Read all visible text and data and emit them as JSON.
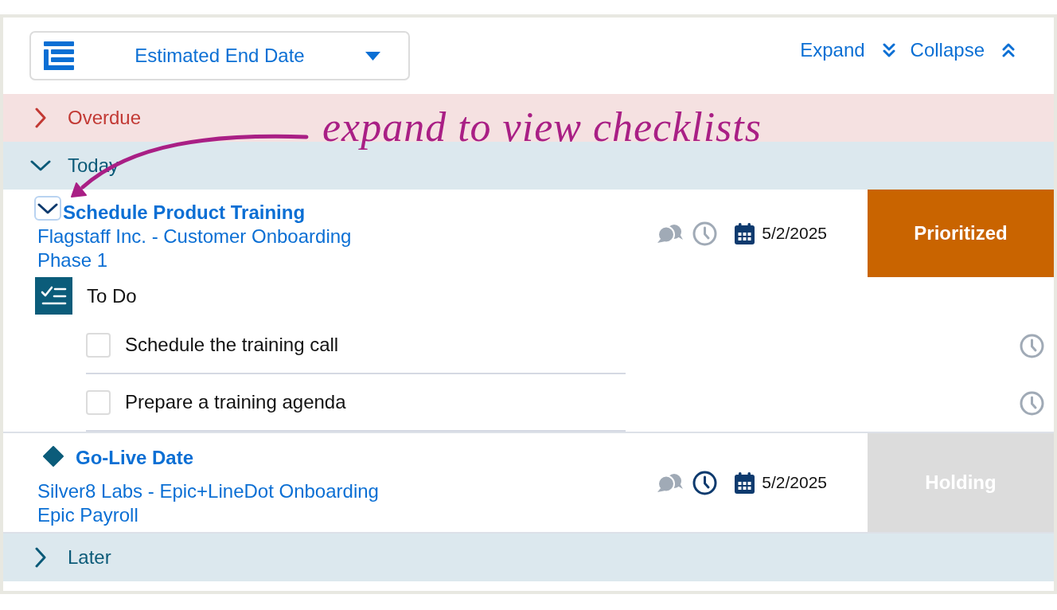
{
  "toolbar": {
    "sort_dropdown": {
      "label": "Estimated End Date"
    },
    "actions": [
      {
        "label": "Expand",
        "kind": "expand"
      },
      {
        "label": "Collapse",
        "kind": "collapse"
      }
    ]
  },
  "annotation": {
    "text": "expand to view checklists"
  },
  "groups": [
    {
      "label": "Overdue",
      "kind": "overdue",
      "expanded": false
    },
    {
      "label": "Today",
      "kind": "default",
      "expanded": true,
      "tasks": [
        {
          "kind": "task",
          "title": "Schedule Product Training",
          "project": "Flagstaff Inc. - Customer Onboarding",
          "phase": "Phase 1",
          "expanded": true,
          "clock_active": false,
          "date": "5/2/2025",
          "status": {
            "label": "Prioritized",
            "color": "#c96400"
          },
          "checklist": {
            "title": "To Do",
            "items": [
              {
                "label": "Schedule the training call",
                "checked": false,
                "clock_active": false
              },
              {
                "label": "Prepare a training agenda",
                "checked": false,
                "clock_active": false
              }
            ]
          }
        },
        {
          "kind": "milestone",
          "title": "Go-Live Date",
          "project": "Silver8 Labs - Epic+LineDot Onboarding",
          "phase": "Epic Payroll",
          "clock_active": true,
          "date": "5/2/2025",
          "status": {
            "label": "Holding",
            "color": "#dcdcdc"
          }
        }
      ]
    },
    {
      "label": "Later",
      "kind": "default",
      "expanded": false
    }
  ]
}
